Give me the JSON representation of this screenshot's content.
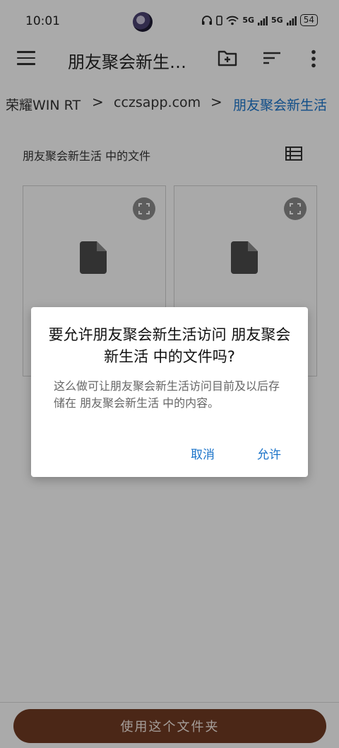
{
  "status_bar": {
    "time": "10:01",
    "network_label": "5G",
    "battery": "54"
  },
  "app_bar": {
    "title": "朋友聚会新生…",
    "icons": [
      "menu-icon",
      "new-folder-icon",
      "sort-icon",
      "more-vert-icon"
    ]
  },
  "breadcrumb": {
    "items": [
      "荣耀WIN RT",
      "cczsapp.com",
      "朋友聚会新生活"
    ],
    "separator": ">"
  },
  "section": {
    "title": "朋友聚会新生活 中的文件"
  },
  "files": {
    "count_visible": 2,
    "icon": "document-icon"
  },
  "bottom": {
    "use_folder_label": "使用这个文件夹"
  },
  "dialog": {
    "title": "要允许朋友聚会新生活访问 朋友聚会新生活 中的文件吗?",
    "message": "这么做可让朋友聚会新生活访问目前及以后存储在 朋友聚会新生活 中的内容。",
    "cancel_label": "取消",
    "allow_label": "允许"
  },
  "colors": {
    "accent": "#1a73c9",
    "primary_button": "#6f3a22",
    "background": "#fbfbfb"
  }
}
